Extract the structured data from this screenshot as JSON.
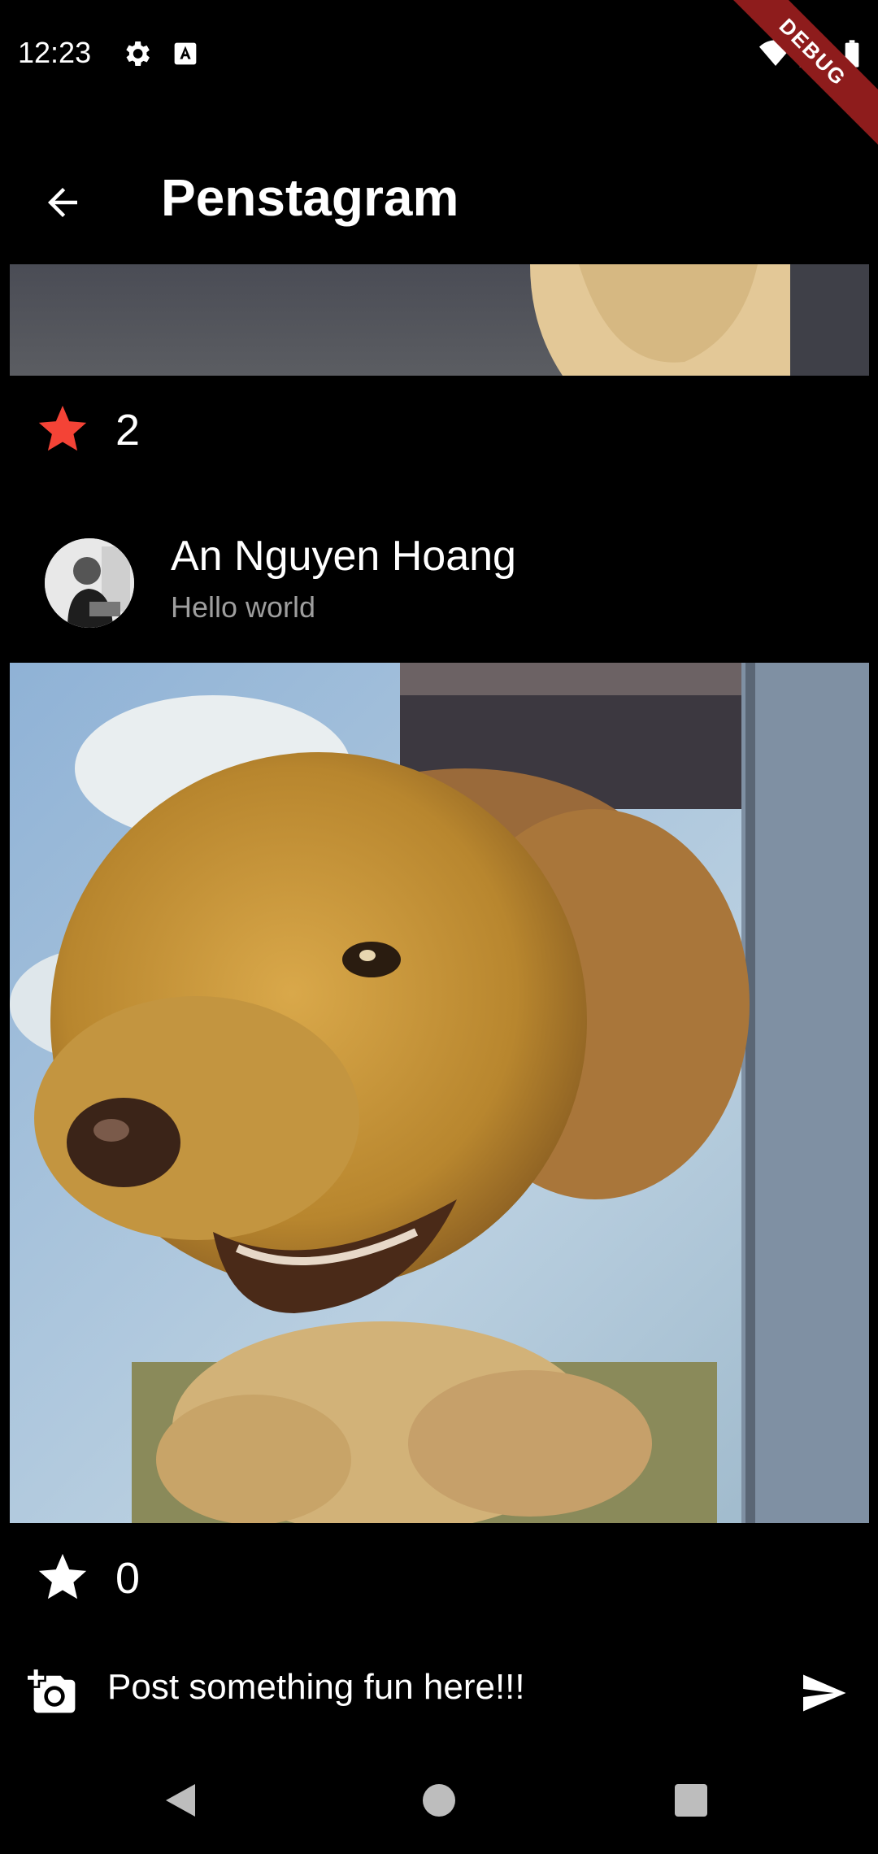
{
  "status_bar": {
    "time": "12:23",
    "icons": [
      "gear-icon",
      "text-a-icon",
      "wifi-icon",
      "signal-icon",
      "battery-icon"
    ],
    "debug_label": "DEBUG"
  },
  "app_bar": {
    "title": "Penstagram",
    "back_icon": "arrow-back-icon"
  },
  "posts": [
    {
      "star_count": "2",
      "starred": true
    },
    {
      "author": "An Nguyen Hoang",
      "message": "Hello world",
      "star_count": "0",
      "starred": false
    }
  ],
  "compose": {
    "placeholder": "Post something fun here!!!",
    "camera_icon": "add-a-photo-icon",
    "send_icon": "send-icon"
  },
  "nav_bar": {
    "icons": [
      "back-triangle-icon",
      "home-circle-icon",
      "recents-square-icon"
    ]
  },
  "colors": {
    "background": "#000000",
    "star_active": "#f44336",
    "subtitle": "#9e9e9e",
    "debug_banner": "#8e1c1c"
  }
}
